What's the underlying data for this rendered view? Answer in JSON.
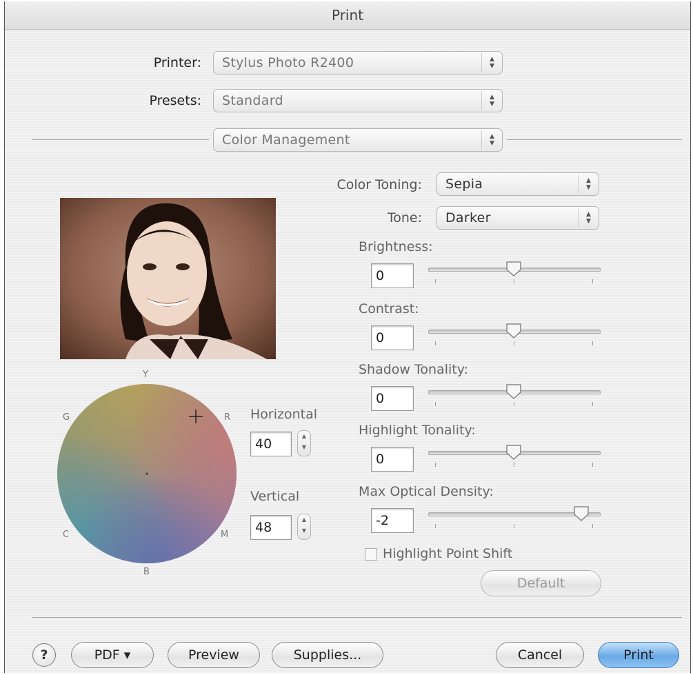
{
  "window": {
    "title": "Print"
  },
  "printer": {
    "label": "Printer:",
    "value": "Stylus Photo R2400"
  },
  "presets": {
    "label": "Presets:",
    "value": "Standard"
  },
  "panel": {
    "value": "Color Management"
  },
  "color_toning": {
    "label": "Color Toning:",
    "value": "Sepia"
  },
  "tone": {
    "label": "Tone:",
    "value": "Darker"
  },
  "sliders": [
    {
      "label": "Brightness:",
      "value": "0",
      "level": 0.5
    },
    {
      "label": "Contrast:",
      "value": "0",
      "level": 0.5
    },
    {
      "label": "Shadow Tonality:",
      "value": "0",
      "level": 0.5
    },
    {
      "label": "Highlight Tonality:",
      "value": "0",
      "level": 0.5
    },
    {
      "label": "Max Optical Density:",
      "value": "-2",
      "level": 0.93
    }
  ],
  "color_wheel": {
    "letters": {
      "top": "Y",
      "upper_left": "G",
      "upper_right": "R",
      "lower_left": "C",
      "lower_right": "M",
      "bottom": "B"
    },
    "horizontal": {
      "label": "Horizontal",
      "value": "40"
    },
    "vertical": {
      "label": "Vertical",
      "value": "48"
    }
  },
  "highlight_point_shift": {
    "label": "Highlight Point Shift",
    "checked": false
  },
  "default_button": "Default",
  "footer": {
    "help": "?",
    "pdf": "PDF ▾",
    "preview": "Preview",
    "supplies": "Supplies...",
    "cancel": "Cancel",
    "print": "Print"
  },
  "colors": {
    "primary_button": "#6aa9e6",
    "sepia_photo": "#7a5040"
  }
}
